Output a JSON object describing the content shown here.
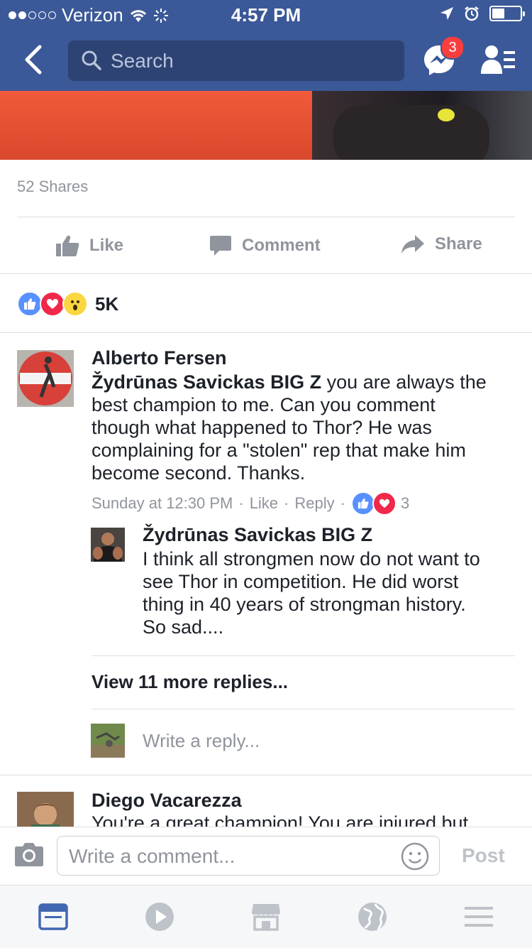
{
  "status_bar": {
    "carrier": "Verizon",
    "time": "4:57 PM"
  },
  "nav": {
    "search_placeholder": "Search",
    "messenger_badge": "3"
  },
  "post": {
    "shares": "52 Shares",
    "actions": {
      "like": "Like",
      "comment": "Comment",
      "share": "Share"
    },
    "reaction_count": "5K"
  },
  "comments": [
    {
      "author": "Alberto Fersen",
      "mention": "Žydrūnas Savickas BIG Z",
      "text": "you are always the best champion to me. Can you comment though what happened to Thor? He was complaining for a \"stolen\" rep that make him become second. Thanks.",
      "lines": [
        "best champion to me. Can you comment",
        "though what happened to Thor? He was",
        "complaining for a \"stolen\" rep that make him",
        "become second. Thanks."
      ],
      "first_line_rest": "you are always the",
      "time": "Sunday at 12:30 PM",
      "like": "Like",
      "reply": "Reply",
      "reaction_count": "3"
    }
  ],
  "reply": {
    "author": "Žydrūnas Savickas BIG Z",
    "lines": [
      "I think all strongmen now do not want to",
      "see Thor in competition. He did worst",
      "thing in 40 years of strongman history.",
      "So sad...."
    ]
  },
  "view_more_replies": "View 11 more replies...",
  "write_reply_placeholder": "Write a reply...",
  "next_comment": {
    "author": "Diego Vacarezza",
    "text_partial": "You're a great champion! You are injured but"
  },
  "composer": {
    "placeholder": "Write a comment...",
    "post_label": "Post"
  },
  "tabbar": {
    "icons": [
      "news-feed-icon",
      "video-icon",
      "marketplace-icon",
      "notifications-globe-icon",
      "menu-icon"
    ]
  },
  "colors": {
    "brand": "#3b5998",
    "like_blue": "#5890ff",
    "love_red": "#f0284a",
    "badge_red": "#fa3e3e",
    "muted": "#90949c"
  }
}
